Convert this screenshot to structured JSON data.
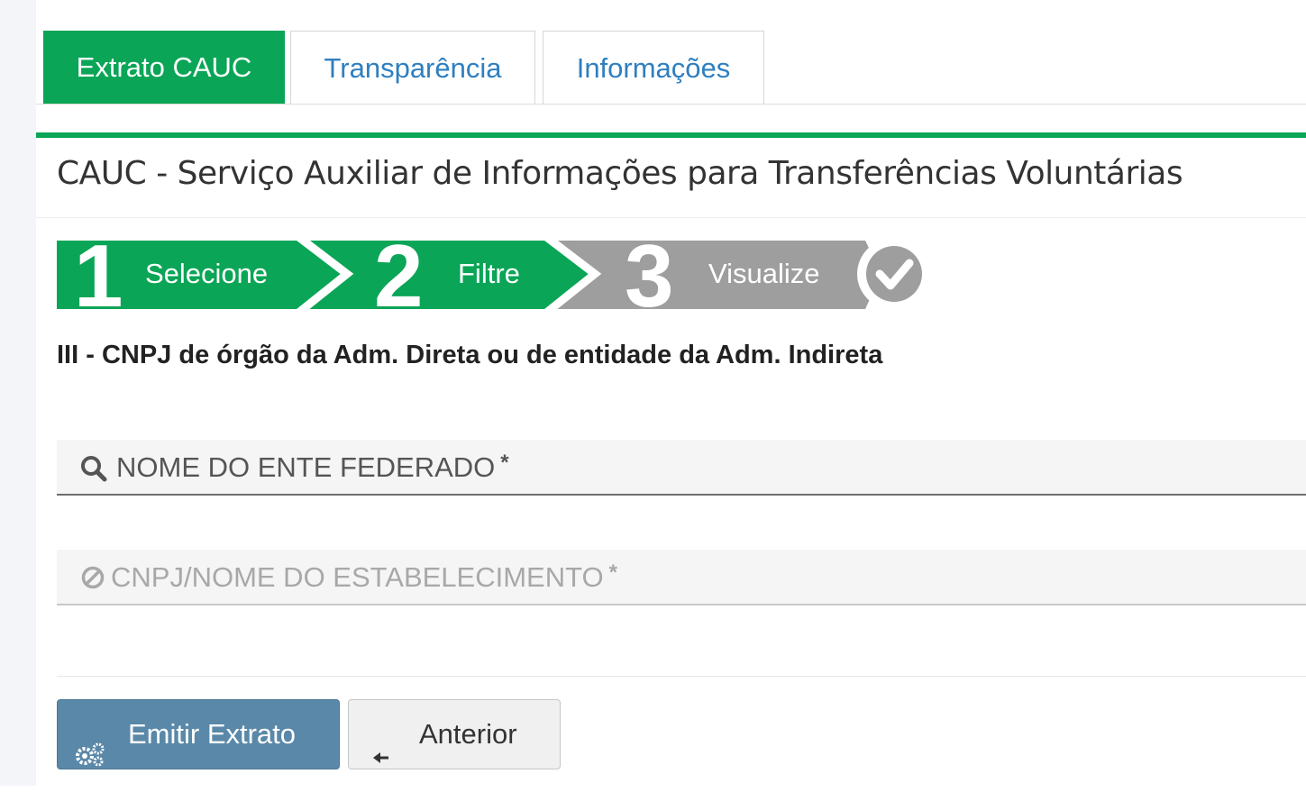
{
  "tabs": [
    {
      "label": "Extrato CAUC",
      "active": true
    },
    {
      "label": "Transparência",
      "active": false
    },
    {
      "label": "Informações",
      "active": false
    }
  ],
  "page_title": "CAUC - Serviço Auxiliar de Informações para Transferências Voluntárias",
  "wizard": {
    "steps": [
      {
        "number": "1",
        "label": "Selecione",
        "status": "completed"
      },
      {
        "number": "2",
        "label": "Filtre",
        "status": "current"
      },
      {
        "number": "3",
        "label": "Visualize",
        "status": "pending"
      }
    ],
    "final_icon": "check-circle-icon"
  },
  "section_heading": "III - CNPJ de órgão da Adm. Direta ou de entidade da Adm. Indireta",
  "fields": {
    "ente_federado": {
      "placeholder": "NOME DO ENTE FEDERADO",
      "required_mark": "*",
      "icon": "search-icon",
      "enabled": true
    },
    "estabelecimento": {
      "placeholder": "CNPJ/NOME DO ESTABELECIMENTO",
      "required_mark": "*",
      "icon": "ban-icon",
      "enabled": false
    }
  },
  "buttons": {
    "emit": {
      "label": "Emitir Extrato",
      "icon": "cogs-icon"
    },
    "back": {
      "label": "Anterior",
      "icon": "arrow-left-icon"
    }
  },
  "colors": {
    "green": "#0aa556",
    "gray_step": "#9e9e9e",
    "link_blue": "#2e7fc0",
    "primary_button": "#5a88a8"
  }
}
